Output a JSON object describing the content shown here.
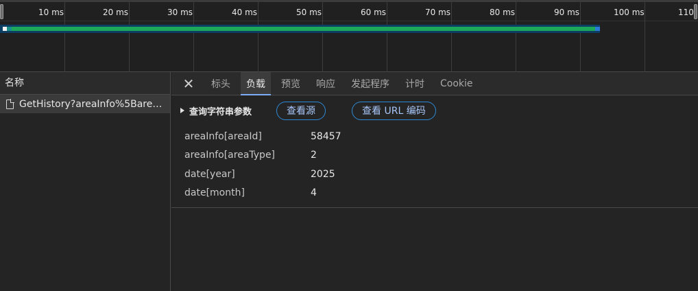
{
  "timeline": {
    "ticks": [
      "10 ms",
      "20 ms",
      "30 ms",
      "40 ms",
      "50 ms",
      "60 ms",
      "70 ms",
      "80 ms",
      "90 ms",
      "100 ms",
      "110"
    ]
  },
  "request_list": {
    "header": "名称",
    "rows": [
      {
        "name": "GetHistory?areaInfo%5Bare…",
        "icon": "document-icon"
      }
    ]
  },
  "details": {
    "tabs": [
      "标头",
      "负载",
      "预览",
      "响应",
      "发起程序",
      "计时",
      "Cookie"
    ],
    "active_tab": "负载",
    "section_title": "查询字符串参数",
    "view_source_label": "查看源",
    "view_url_encoded_label": "查看 URL 编码",
    "params": [
      {
        "key": "areaInfo[areaId]",
        "value": "58457"
      },
      {
        "key": "areaInfo[areaType]",
        "value": "2"
      },
      {
        "key": "date[year]",
        "value": "2025"
      },
      {
        "key": "date[month]",
        "value": "4"
      }
    ]
  },
  "colors": {
    "accent": "#7cacf8",
    "pill_border": "#2e8ad8",
    "bar_green": "#1ea85a",
    "bar_blue": "#2a7ad8"
  }
}
